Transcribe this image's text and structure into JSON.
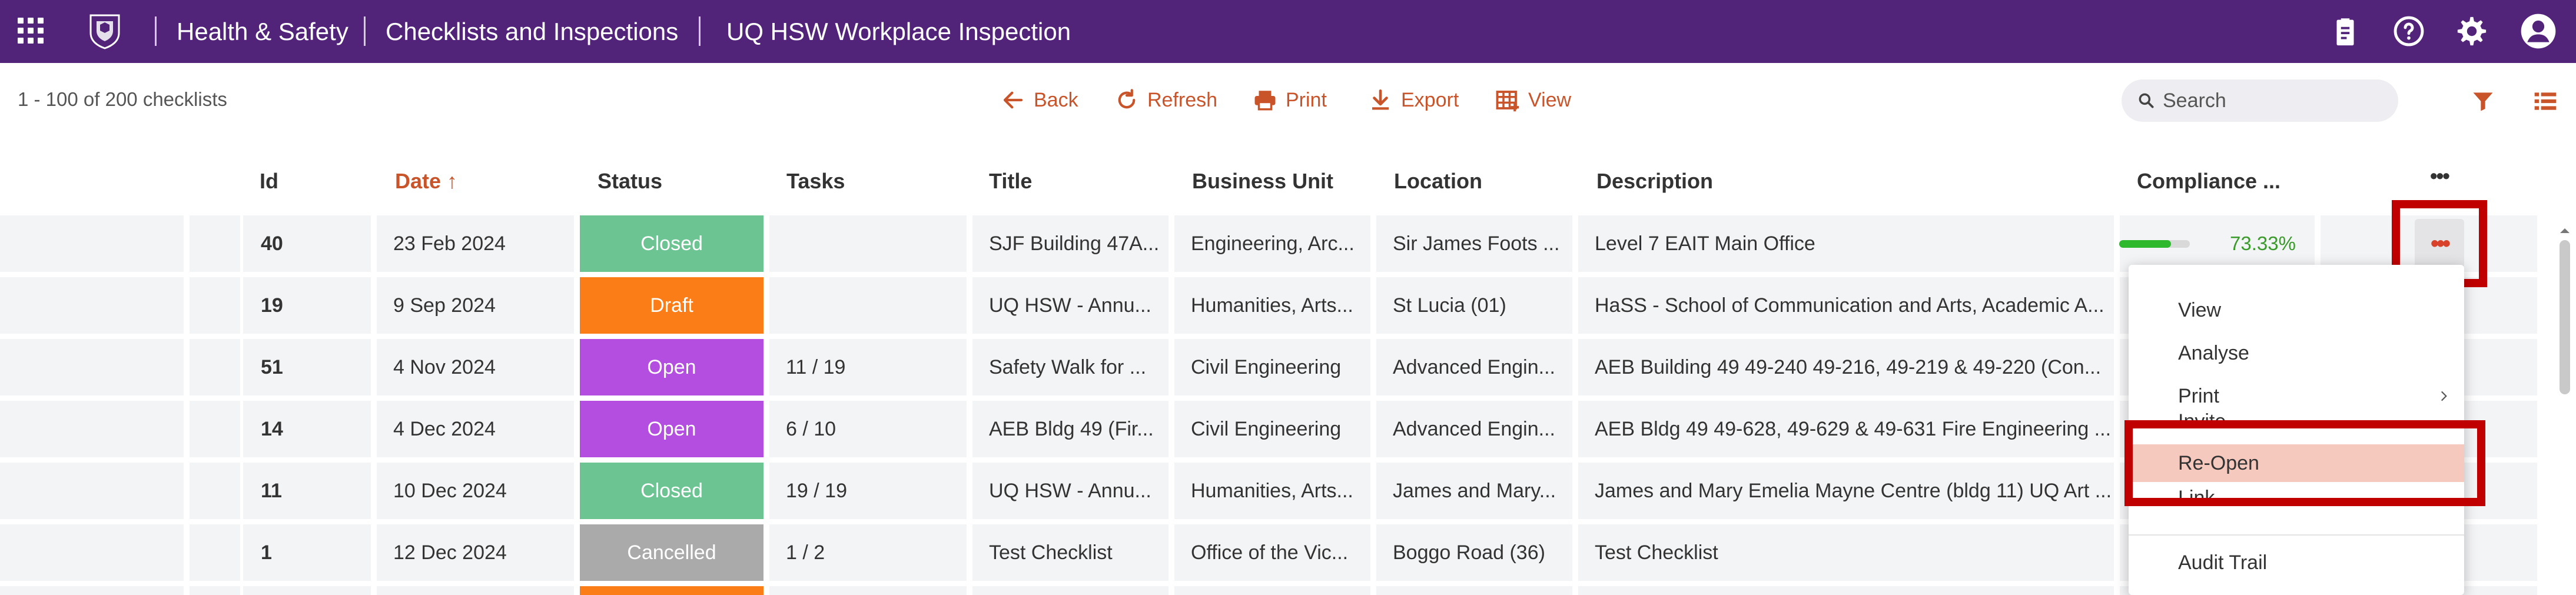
{
  "header": {
    "breadcrumbs": [
      "Health & Safety",
      "Checklists and Inspections",
      "UQ HSW Workplace Inspection"
    ],
    "icons": [
      "apps-grid-icon",
      "uq-crest-icon",
      "clipboard-icon",
      "help-icon",
      "gear-icon",
      "account-icon"
    ]
  },
  "toolbar": {
    "count": "1 - 100 of 200 checklists",
    "back": "Back",
    "refresh": "Refresh",
    "print": "Print",
    "export": "Export",
    "view": "View",
    "search_placeholder": "Search"
  },
  "table": {
    "columns": {
      "id": "Id",
      "date": "Date ↑",
      "status": "Status",
      "tasks": "Tasks",
      "title": "Title",
      "business_unit": "Business Unit",
      "location": "Location",
      "description": "Description",
      "compliance": "Compliance ...",
      "actions": "•••"
    },
    "rows": [
      {
        "id": "40",
        "date": "23 Feb 2024",
        "status": "Closed",
        "tasks": "",
        "title": "SJF Building 47A...",
        "business_unit": "Engineering, Arc...",
        "location": "Sir James Foots ...",
        "description": "Level 7 EAIT Main Office",
        "compliance": "73.33%",
        "compliance_value": 0.7333
      },
      {
        "id": "19",
        "date": "9 Sep 2024",
        "status": "Draft",
        "tasks": "",
        "title": "UQ HSW - Annu...",
        "business_unit": "Humanities, Arts...",
        "location": "St Lucia (01)",
        "description": "HaSS - School of Communication and Arts, Academic A...",
        "compliance": ""
      },
      {
        "id": "51",
        "date": "4 Nov 2024",
        "status": "Open",
        "tasks": "11 / 19",
        "title": "Safety Walk for ...",
        "business_unit": "Civil Engineering",
        "location": "Advanced Engin...",
        "description": "AEB Building 49 49-240 49-216, 49-219 & 49-220 (Con...",
        "compliance": ""
      },
      {
        "id": "14",
        "date": "4 Dec 2024",
        "status": "Open",
        "tasks": "6 / 10",
        "title": "AEB Bldg 49 (Fir...",
        "business_unit": "Civil Engineering",
        "location": "Advanced Engin...",
        "description": "AEB Bldg 49 49-628, 49-629 & 49-631 Fire Engineering ...",
        "compliance": ""
      },
      {
        "id": "11",
        "date": "10 Dec 2024",
        "status": "Closed",
        "tasks": "19 / 19",
        "title": "UQ HSW - Annu...",
        "business_unit": "Humanities, Arts...",
        "location": "James and Mary...",
        "description": "James and Mary Emelia Mayne Centre (bldg 11) UQ Art ...",
        "compliance": ""
      },
      {
        "id": "1",
        "date": "12 Dec 2024",
        "status": "Cancelled",
        "tasks": "1 / 2",
        "title": "Test Checklist",
        "business_unit": "Office of the Vic...",
        "location": "Boggo Road (36)",
        "description": "Test Checklist",
        "compliance": ""
      }
    ]
  },
  "status_colors": {
    "Closed": "#6cc493",
    "Draft": "#fb7d18",
    "Open": "#b34ee0",
    "Cancelled": "#aaaaaa"
  },
  "row_more_label": "•••",
  "context_menu": {
    "items": [
      "View",
      "Analyse",
      "Print",
      "Invite",
      "Re-Open",
      "Link",
      "Audit Trail"
    ],
    "active": "Re-Open"
  },
  "accent_color": "#c9542a",
  "brand_color": "#51247a"
}
